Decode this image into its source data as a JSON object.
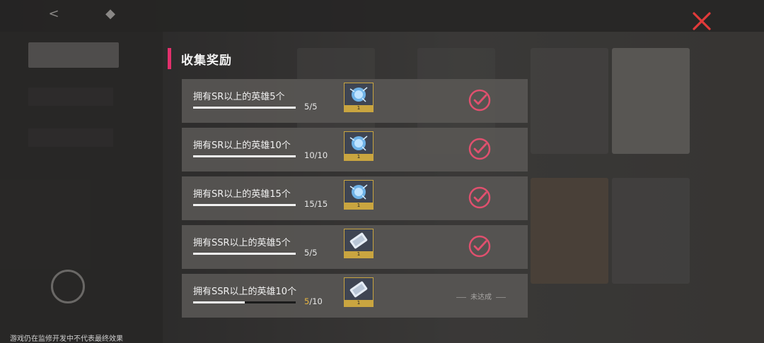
{
  "panel": {
    "title": "收集奖励"
  },
  "rows": [
    {
      "label": "拥有SR以上的英雄5个",
      "current": "5",
      "total": "/5",
      "progress": 1.0,
      "reward_qty": "1",
      "reward_icon": "blue-crystal-orb-icon",
      "completed": true
    },
    {
      "label": "拥有SR以上的英雄10个",
      "current": "10",
      "total": "/10",
      "progress": 1.0,
      "reward_qty": "1",
      "reward_icon": "blue-crystal-orb-icon",
      "completed": true
    },
    {
      "label": "拥有SR以上的英雄15个",
      "current": "15",
      "total": "/15",
      "progress": 1.0,
      "reward_qty": "1",
      "reward_icon": "blue-crystal-orb-icon",
      "completed": true
    },
    {
      "label": "拥有SSR以上的英雄5个",
      "current": "5",
      "total": "/5",
      "progress": 1.0,
      "reward_qty": "1",
      "reward_icon": "summon-ticket-icon",
      "completed": true
    },
    {
      "label": "拥有SSR以上的英雄10个",
      "current": "5",
      "total": "/10",
      "progress": 0.5,
      "reward_qty": "1",
      "reward_icon": "summon-ticket-icon",
      "completed": false,
      "status_text": "未达成"
    }
  ],
  "footer": {
    "note": "游戏仍在监修开发中不代表最终效果"
  },
  "colors": {
    "accent": "#e2306c",
    "check": "#e0506e",
    "partial": "#e8b640"
  }
}
